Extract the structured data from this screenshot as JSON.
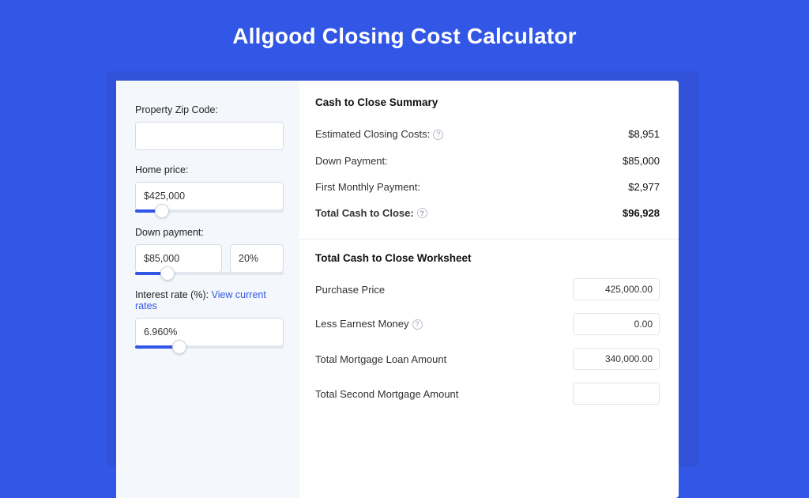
{
  "page_title": "Allgood Closing Cost Calculator",
  "colors": {
    "accent": "#3256e5"
  },
  "form": {
    "zip": {
      "label": "Property Zip Code:",
      "value": ""
    },
    "home_price": {
      "label": "Home price:",
      "value": "$425,000",
      "slider_pct": 18
    },
    "down_payment": {
      "label": "Down payment:",
      "value": "$85,000",
      "pct": "20%",
      "slider_pct": 22
    },
    "interest_rate": {
      "label": "Interest rate (%):",
      "link": "View current rates",
      "value": "6.960%",
      "slider_pct": 30
    }
  },
  "summary": {
    "heading": "Cash to Close Summary",
    "rows": [
      {
        "label": "Estimated Closing Costs:",
        "help": true,
        "value": "$8,951",
        "bold": false
      },
      {
        "label": "Down Payment:",
        "help": false,
        "value": "$85,000",
        "bold": false
      },
      {
        "label": "First Monthly Payment:",
        "help": false,
        "value": "$2,977",
        "bold": false
      },
      {
        "label": "Total Cash to Close:",
        "help": true,
        "value": "$96,928",
        "bold": true
      }
    ]
  },
  "worksheet": {
    "heading": "Total Cash to Close Worksheet",
    "rows": [
      {
        "label": "Purchase Price",
        "help": false,
        "value": "425,000.00"
      },
      {
        "label": "Less Earnest Money",
        "help": true,
        "value": "0.00"
      },
      {
        "label": "Total Mortgage Loan Amount",
        "help": false,
        "value": "340,000.00"
      },
      {
        "label": "Total Second Mortgage Amount",
        "help": false,
        "value": ""
      }
    ]
  }
}
